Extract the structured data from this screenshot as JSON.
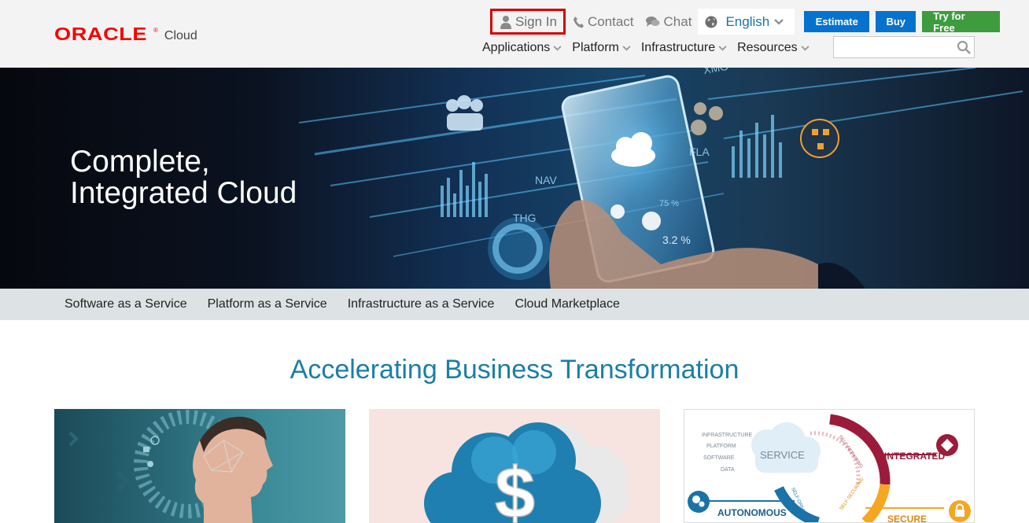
{
  "header": {
    "logo_brand": "ORACLE",
    "logo_registered": "®",
    "logo_product": "Cloud",
    "util": {
      "sign_in": "Sign In",
      "contact": "Contact",
      "chat": "Chat",
      "language": "English"
    },
    "buttons": {
      "estimate": "Estimate",
      "buy": "Buy",
      "try_free": "Try for Free"
    },
    "nav": [
      "Applications",
      "Platform",
      "Infrastructure",
      "Resources"
    ],
    "search": {
      "placeholder": ""
    }
  },
  "hero": {
    "title_line1": "Complete,",
    "title_line2": "Integrated Cloud",
    "overlay_text": [
      "XMG",
      "FLA",
      "NAV",
      "THG",
      "75 %",
      "3.2 %"
    ]
  },
  "subnav": [
    "Software as a Service",
    "Platform as a Service",
    "Infrastructure as a Service",
    "Cloud Marketplace"
  ],
  "section": {
    "title": "Accelerating Business Transformation"
  },
  "cards": {
    "card3": {
      "layers": [
        "INFRASTRUCTURE",
        "PLATFORM",
        "SOFTWARE",
        "DATA"
      ],
      "service": "SERVICE",
      "integrated": "INTEGRATED",
      "autonomous": "AUTONOMOUS",
      "secure": "SECURE",
      "self_repairing": "SELF-REPAIRING",
      "self_driving": "SELF-DRIVING",
      "self_securing": "SELF-SECURING"
    }
  },
  "colors": {
    "oracle_red": "#f80000",
    "primary_blue": "#0572ce",
    "try_green": "#3e9b3e",
    "section_title_blue": "#1a7ea8",
    "signin_highlight": "#d40000"
  }
}
